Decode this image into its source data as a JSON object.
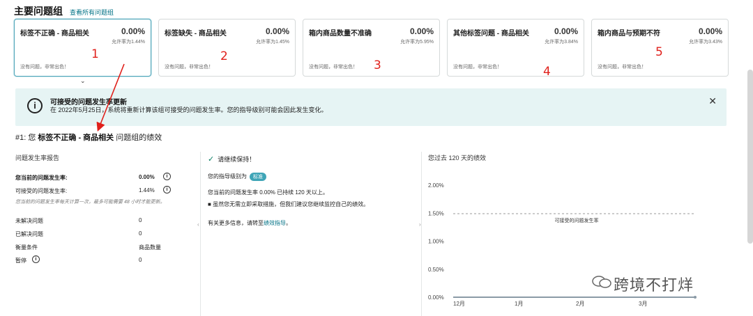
{
  "header": {
    "title": "主要问题组",
    "view_all": "查看所有问题组"
  },
  "cards": [
    {
      "name": "标签不正确 - 商品相关",
      "rate": "0.00%",
      "allowed": "允许率为1.44%",
      "status": "没有问题，非常出色！",
      "annotation": "1",
      "selected": true
    },
    {
      "name": "标签缺失 - 商品相关",
      "rate": "0.00%",
      "allowed": "允许率为1.45%",
      "status": "没有问题，非常出色！",
      "annotation": "2",
      "selected": false
    },
    {
      "name": "箱内商品数量不准确",
      "rate": "0.00%",
      "allowed": "允许率为5.95%",
      "status": "没有问题，非常出色！",
      "annotation": "3",
      "selected": false
    },
    {
      "name": "其他标签问题 - 商品相关",
      "rate": "0.00%",
      "allowed": "允许率为3.84%",
      "status": "没有问题，非常出色！",
      "annotation": "4",
      "selected": false
    },
    {
      "name": "箱内商品与预期不符",
      "rate": "0.00%",
      "allowed": "允许率为3.43%",
      "status": "没有问题，非常出色！",
      "annotation": "5",
      "selected": false
    }
  ],
  "chevron": "⌄",
  "alert": {
    "icon": "info-icon",
    "title": "可接受的问题发生率更新",
    "body": "在 2022年5月25日，系统将重新计算该组可接受的问题发生率。您的指导级别可能会因此发生变化。",
    "close": "✕"
  },
  "subhead": {
    "prefix": "#1: 您 ",
    "group": "标签不正确 - 商品相关",
    "suffix": " 问题组的绩效"
  },
  "report": {
    "title": "问题发生率报告",
    "current_label": "您当前的问题发生率:",
    "current_value": "0.00%",
    "accept_label": "可接受的问题发生率:",
    "accept_value": "1.44%",
    "info": "i",
    "note": "您当前的问题发生率每天计算一次，最多可能需要 48 小时才能更新。",
    "rows": [
      {
        "label": "未解决问题",
        "value": "0"
      },
      {
        "label": "已解决问题",
        "value": "0"
      },
      {
        "label": "衡量条件",
        "value": "商品数量"
      },
      {
        "label": "暂停",
        "value": "0"
      }
    ]
  },
  "guidance": {
    "check": "✓",
    "keep": "请继续保持！",
    "level_label": "您的指导级别为",
    "level_badge": "标准",
    "line1": "您当前的问题发生率 0.00% 已持续 120 天以上。",
    "bullet": "虽然您无需立即采取措施，但我们建议您继续监控自己的绩效。",
    "more_prefix": "有关更多信息，请转至",
    "more_link": "绩效指导",
    "more_suffix": "。"
  },
  "perf": {
    "title": "您过去 120 天的绩效",
    "threshold_label": "可接受的问题发生率",
    "watermark": "跨境不打烊"
  },
  "chart_data": {
    "type": "line",
    "title": "您过去 120 天的绩效",
    "x_ticks": [
      "12月",
      "1月",
      "2月",
      "3月"
    ],
    "y_ticks": [
      "0.00%",
      "0.50%",
      "1.00%",
      "1.50%",
      "2.00%"
    ],
    "ylim": [
      0,
      2.0
    ],
    "series": [
      {
        "values": [
          0,
          0,
          0,
          0,
          0
        ]
      }
    ],
    "threshold": {
      "name": "可接受的问题发生率",
      "value": 1.44
    },
    "colors": {
      "line": "#8a9aa6",
      "threshold": "#999999"
    }
  },
  "colors": {
    "accent": "#007185",
    "alert_bg": "#e6f4f4",
    "annotation": "#e0201b",
    "badge": "#3fa5b7"
  }
}
